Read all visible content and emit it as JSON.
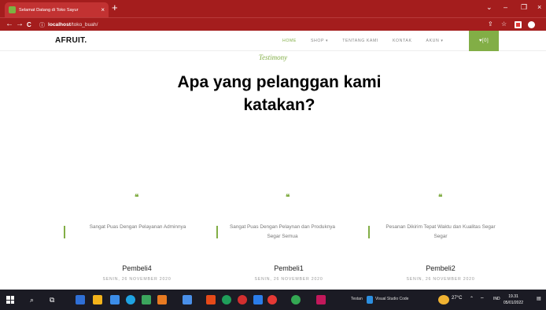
{
  "browser": {
    "tab_title": "Selamat Datang di Toko Sayur",
    "tab_close": "×",
    "new_tab": "+",
    "url_host": "localhost",
    "url_path": "/toko_buah/",
    "back": "←",
    "forward": "→",
    "reload": "C",
    "info": "ⓘ",
    "minimize": "‒",
    "restore": "❐",
    "close": "×",
    "star": "☆",
    "share": "⇪"
  },
  "site": {
    "brand": "AFRUIT.",
    "menu": [
      "HOME",
      "SHOP ▾",
      "TENTANG KAMI",
      "KONTAK",
      "AKUN ▾"
    ],
    "cart": "♥[0]"
  },
  "hero": {
    "subheading": "Testimony",
    "heading": "Apa yang pelanggan kami katakan?"
  },
  "testimonials": [
    {
      "quote": "❝",
      "text": "Sangat Puas Dengan Pelayanan Adminnya",
      "name": "Pembeli4",
      "date": "SENIN, 26 NOVEMBER 2020"
    },
    {
      "quote": "❝",
      "text": "Sangat Puas Dengan Pelaynan dan Produknya Segar Semua",
      "name": "Pembeli1",
      "date": "SENIN, 26 NOVEMBER 2020"
    },
    {
      "quote": "❝",
      "text": "Pesanan Dikirim Tepat Waktu dan Kualitas Segar Segar",
      "name": "Pembeli2",
      "date": "SENIN, 26 NOVEMBER 2020"
    }
  ],
  "taskbar": {
    "search": "⌕",
    "taskview": "⧉",
    "app_label_1": "Testan",
    "app_label_2": "Visual Studio Code",
    "weather": "27°C",
    "chevron": "⌃",
    "lang": "IND",
    "time": "19.31",
    "date": "05/01/2022",
    "notif": "▤"
  },
  "colors": {
    "chrome": "#a41d1d",
    "accent": "#82ae46",
    "taskbar": "#1b1b24"
  }
}
